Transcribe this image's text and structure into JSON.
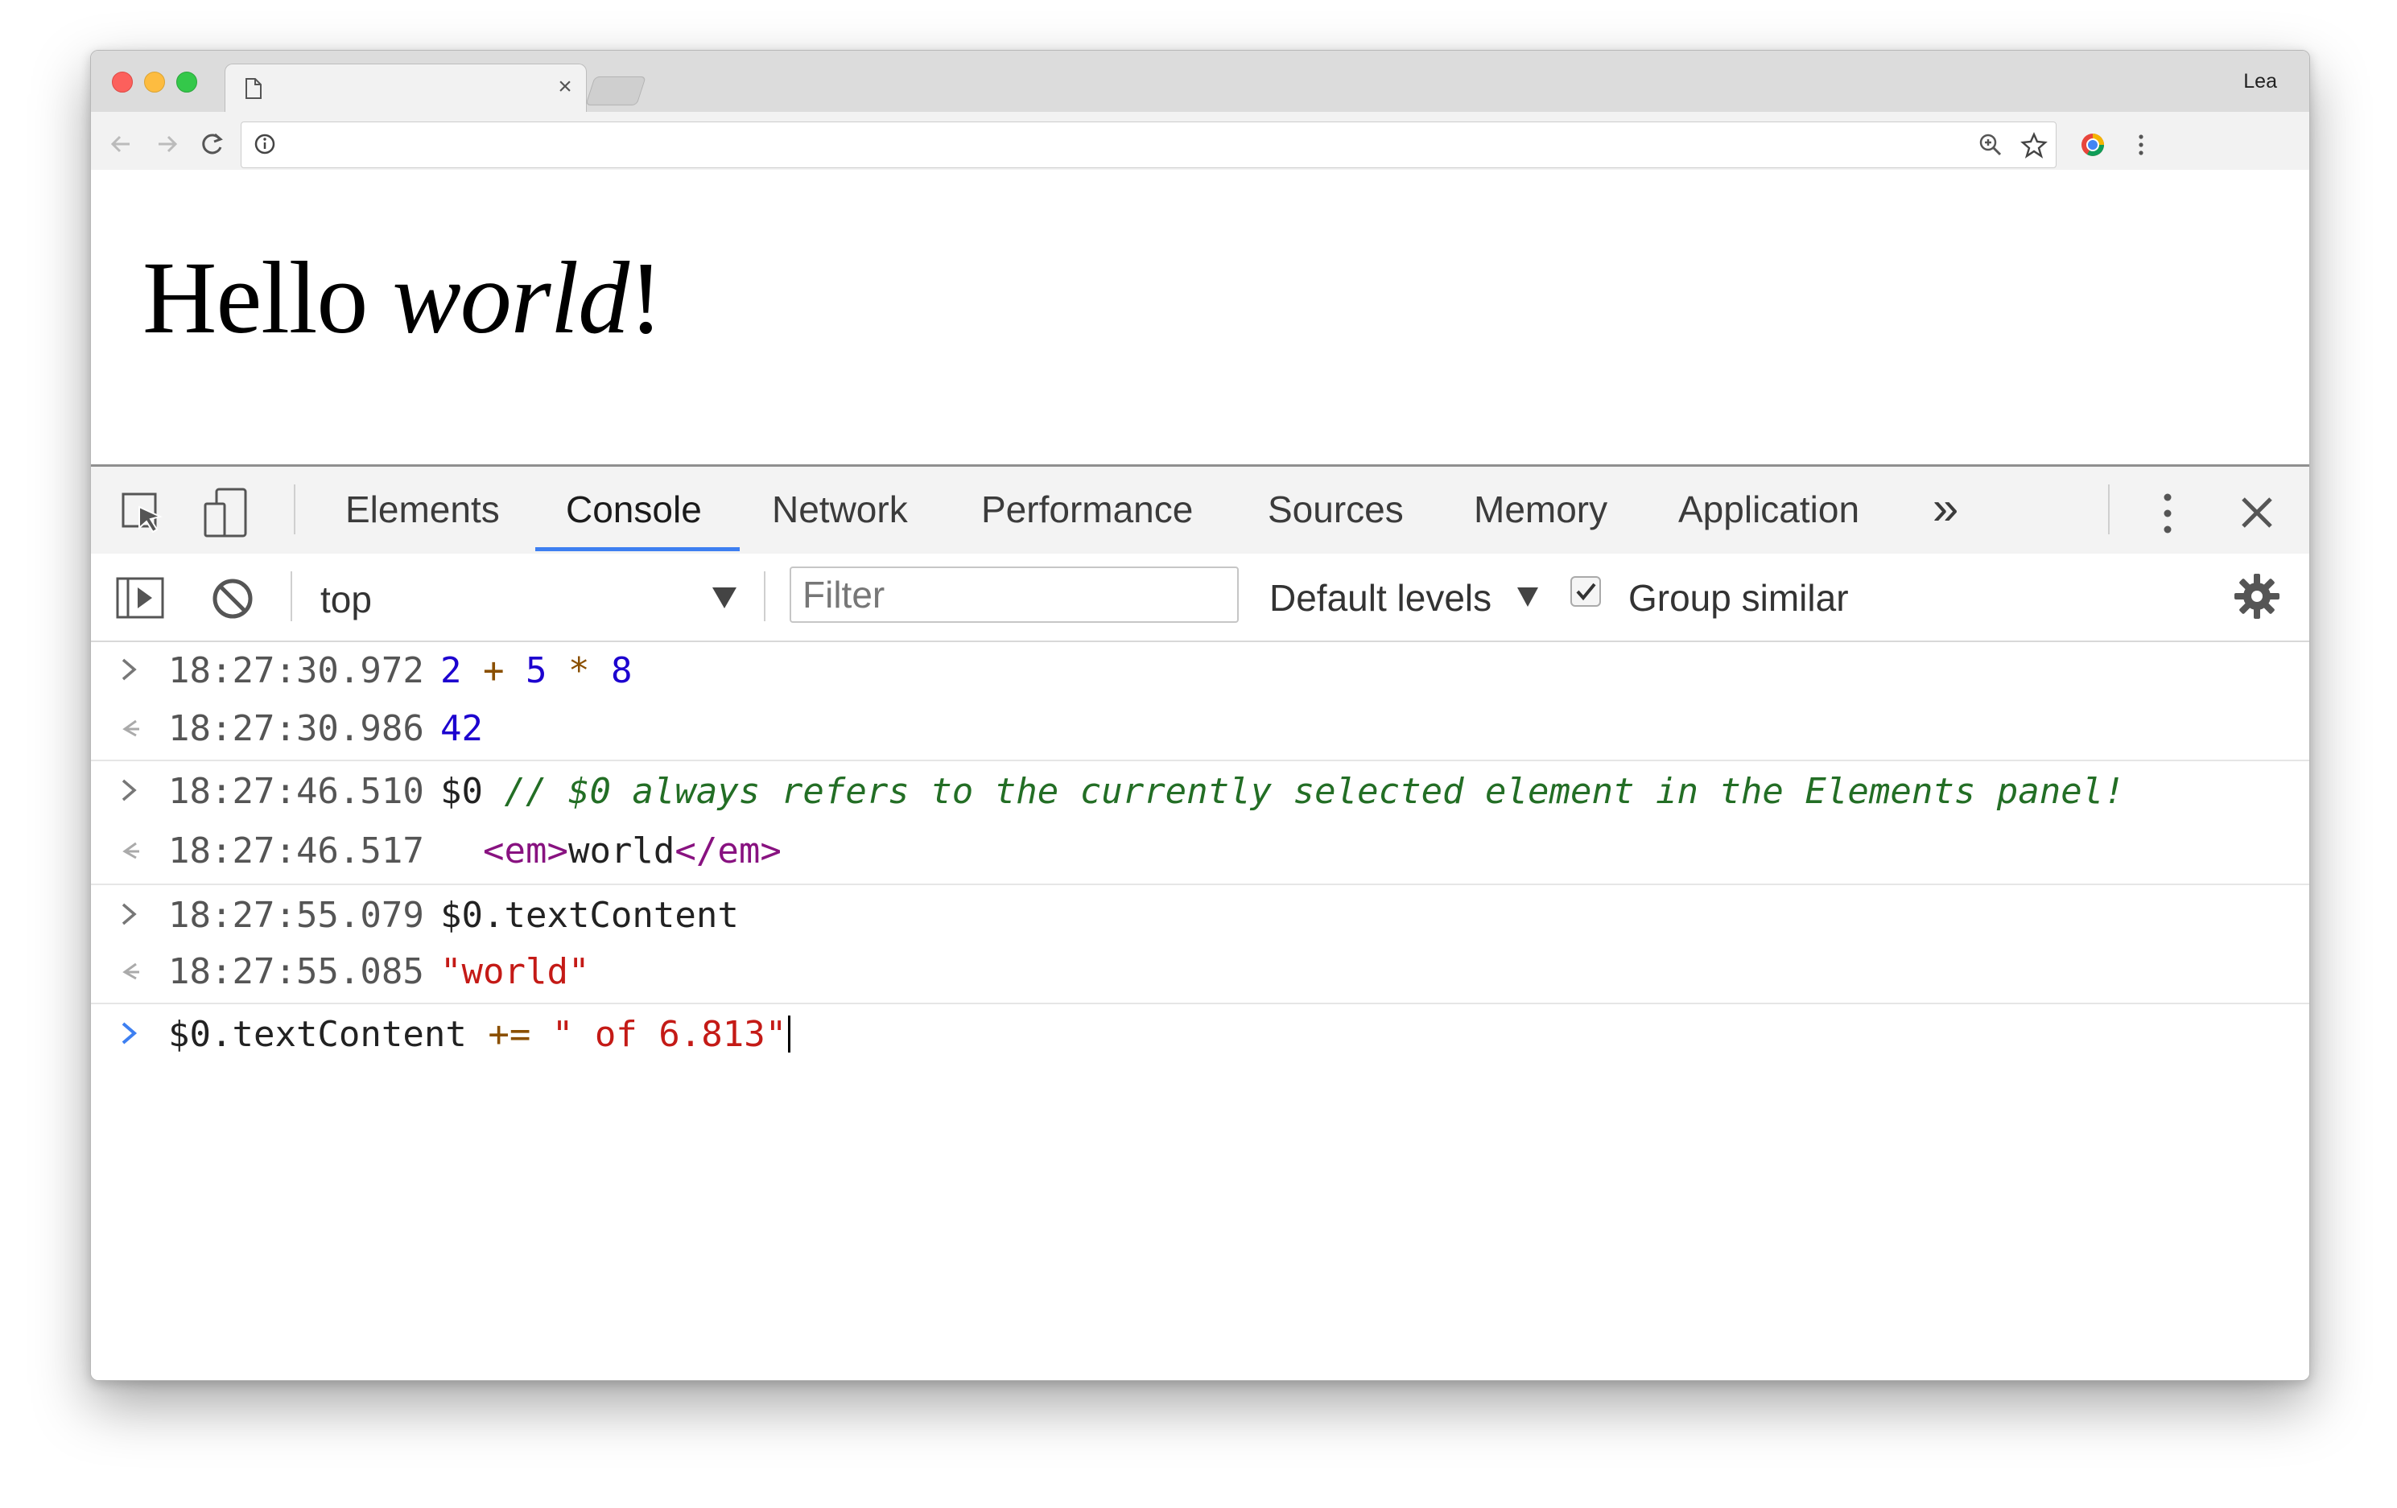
{
  "browser": {
    "profile_name": "Lea",
    "tab_close_glyph": "×",
    "icons": [
      "page-icon",
      "back-arrow-icon",
      "forward-arrow-icon",
      "reload-icon",
      "info-icon",
      "zoom-icon",
      "star-icon",
      "extension-icon",
      "menu-icon"
    ]
  },
  "page": {
    "heading_plain": "Hello ",
    "heading_italic": "world",
    "heading_end": "!"
  },
  "devtools": {
    "tabs": [
      {
        "label": "Elements"
      },
      {
        "label": "Console"
      },
      {
        "label": "Network"
      },
      {
        "label": "Performance"
      },
      {
        "label": "Sources"
      },
      {
        "label": "Memory"
      },
      {
        "label": "Application"
      }
    ],
    "active_tab": "Console",
    "more_tabs_glyph": "»",
    "accent_color": "#3d7ff1",
    "console_toolbar": {
      "context": "top",
      "filter_placeholder": "Filter",
      "levels_label": "Default levels",
      "group_similar_label": "Group similar",
      "group_similar_checked": true
    },
    "console_lines": [
      {
        "kind": "input",
        "timestamp": "18:27:30.972",
        "tokens": [
          [
            "num",
            "2"
          ],
          [
            "op",
            " + "
          ],
          [
            "num",
            "5"
          ],
          [
            "op",
            " * "
          ],
          [
            "num",
            "8"
          ]
        ]
      },
      {
        "kind": "output",
        "timestamp": "18:27:30.986",
        "tokens": [
          [
            "num",
            "42"
          ]
        ]
      },
      {
        "kind": "input",
        "timestamp": "18:27:46.510",
        "tokens": [
          [
            "ident",
            "$0 "
          ],
          [
            "cm",
            "// $0 always refers to the currently selected element in the Elements panel!"
          ]
        ]
      },
      {
        "kind": "output",
        "timestamp": "18:27:46.517",
        "tokens": [
          [
            "tag",
            "  <em>"
          ],
          [
            "tagtxt",
            "world"
          ],
          [
            "tag",
            "</em>"
          ]
        ]
      },
      {
        "kind": "input",
        "timestamp": "18:27:55.079",
        "tokens": [
          [
            "ident",
            "$0.textContent"
          ]
        ]
      },
      {
        "kind": "output",
        "timestamp": "18:27:55.085",
        "tokens": [
          [
            "str",
            "\"world\""
          ]
        ]
      }
    ],
    "prompt": {
      "tokens": [
        [
          "ident",
          "$0.textContent "
        ],
        [
          "op",
          "+="
        ],
        [
          "str",
          " \" of 6.813\""
        ]
      ]
    }
  }
}
